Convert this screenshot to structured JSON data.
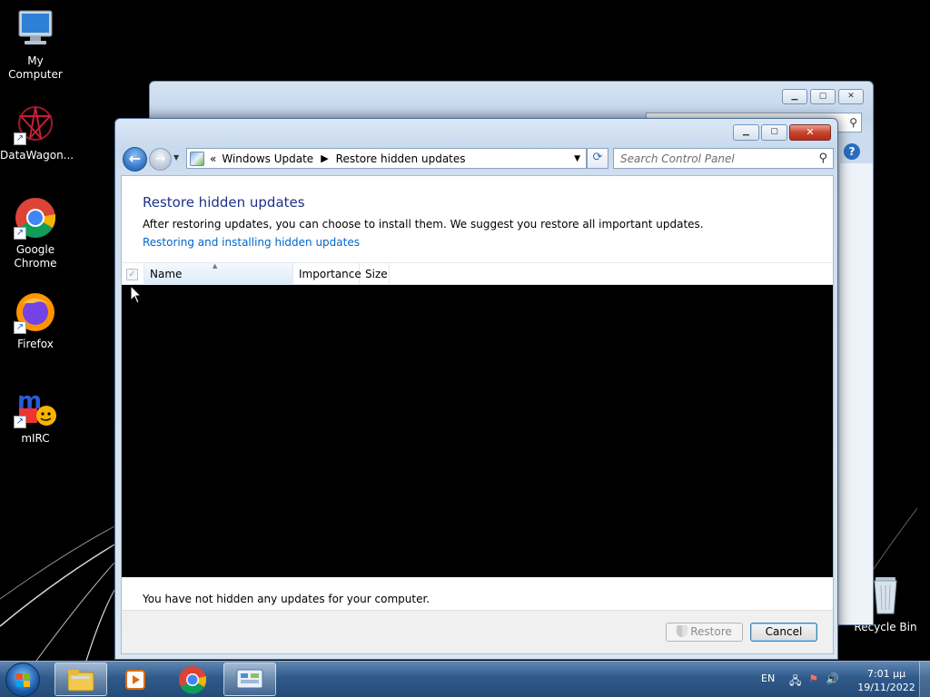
{
  "desktop": {
    "icons": [
      {
        "label": "My Computer"
      },
      {
        "label": "DataWagon..."
      },
      {
        "label": "Google Chrome"
      },
      {
        "label": "Firefox"
      },
      {
        "label": "mIRC"
      },
      {
        "label": "Recycle Bin"
      }
    ]
  },
  "window": {
    "address": {
      "root": "«",
      "crumbs": [
        "Windows Update",
        "Restore hidden updates"
      ]
    },
    "search_placeholder": "Search Control Panel",
    "title": "Restore hidden updates",
    "description": "After restoring updates, you can choose to install them. We suggest you restore all important updates.",
    "link": "Restoring and installing hidden updates",
    "columns": [
      "Name",
      "Importance",
      "Size"
    ],
    "status": "You have not hidden any updates for your computer.",
    "buttons": {
      "restore": "Restore",
      "cancel": "Cancel"
    }
  },
  "taskbar": {
    "language": "EN",
    "time": "7:01 μμ",
    "date": "19/11/2022"
  },
  "colors": {
    "link": "#0066cc",
    "title": "#1e3287",
    "taskbar": "#2f5a8a"
  }
}
